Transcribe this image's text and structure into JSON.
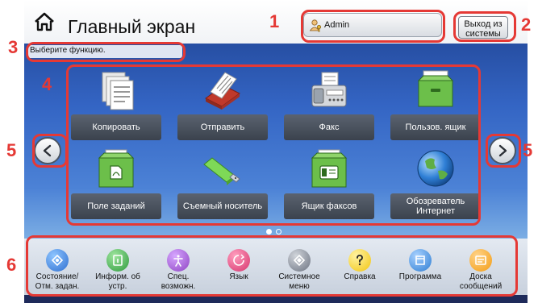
{
  "header": {
    "title": "Главный экран",
    "home_icon": "home-icon"
  },
  "user": {
    "name": "Admin",
    "icon": "user-key-icon"
  },
  "logout": {
    "label": "Выход из системы"
  },
  "message": {
    "text": "Выберите функцию."
  },
  "functions": [
    {
      "label": "Копировать",
      "icon": "copy-icon"
    },
    {
      "label": "Отправить",
      "icon": "send-icon"
    },
    {
      "label": "Факс",
      "icon": "fax-icon"
    },
    {
      "label": "Пользов. ящик",
      "icon": "user-box-icon"
    },
    {
      "label": "Поле заданий",
      "icon": "job-box-icon"
    },
    {
      "label": "Съемный носитель",
      "icon": "removable-media-icon"
    },
    {
      "label": "Ящик факсов",
      "icon": "fax-box-icon"
    },
    {
      "label": "Обозреватель Интернет",
      "icon": "internet-browser-icon"
    }
  ],
  "navigation": {
    "previous_icon": "chevron-left-icon",
    "next_icon": "chevron-right-icon",
    "pages": 2,
    "current_page": 1
  },
  "task_bar": [
    {
      "label": "Состояние/ Отм. задан.",
      "icon": "status-icon",
      "color": "#2f6fd0"
    },
    {
      "label": "Информ. об устр.",
      "icon": "device-info-icon",
      "color": "#2e9a3c"
    },
    {
      "label": "Спец. возможн.",
      "icon": "accessibility-icon",
      "color": "#8e44c2"
    },
    {
      "label": "Язык",
      "icon": "language-icon",
      "color": "#d6336c"
    },
    {
      "label": "Системное меню",
      "icon": "system-menu-icon",
      "color": "#6b7280"
    },
    {
      "label": "Справка",
      "icon": "help-icon",
      "color": "#f1c40f"
    },
    {
      "label": "Программа",
      "icon": "program-icon",
      "color": "#2d7dd2"
    },
    {
      "label": "Доска сообщений",
      "icon": "message-board-icon",
      "color": "#f39c12"
    }
  ],
  "callouts": [
    "1",
    "2",
    "3",
    "4",
    "5",
    "5",
    "6"
  ],
  "colors": {
    "callout": "#e53935",
    "tile_label_bg": "#4a515c",
    "header_bg": "#ffffff"
  }
}
